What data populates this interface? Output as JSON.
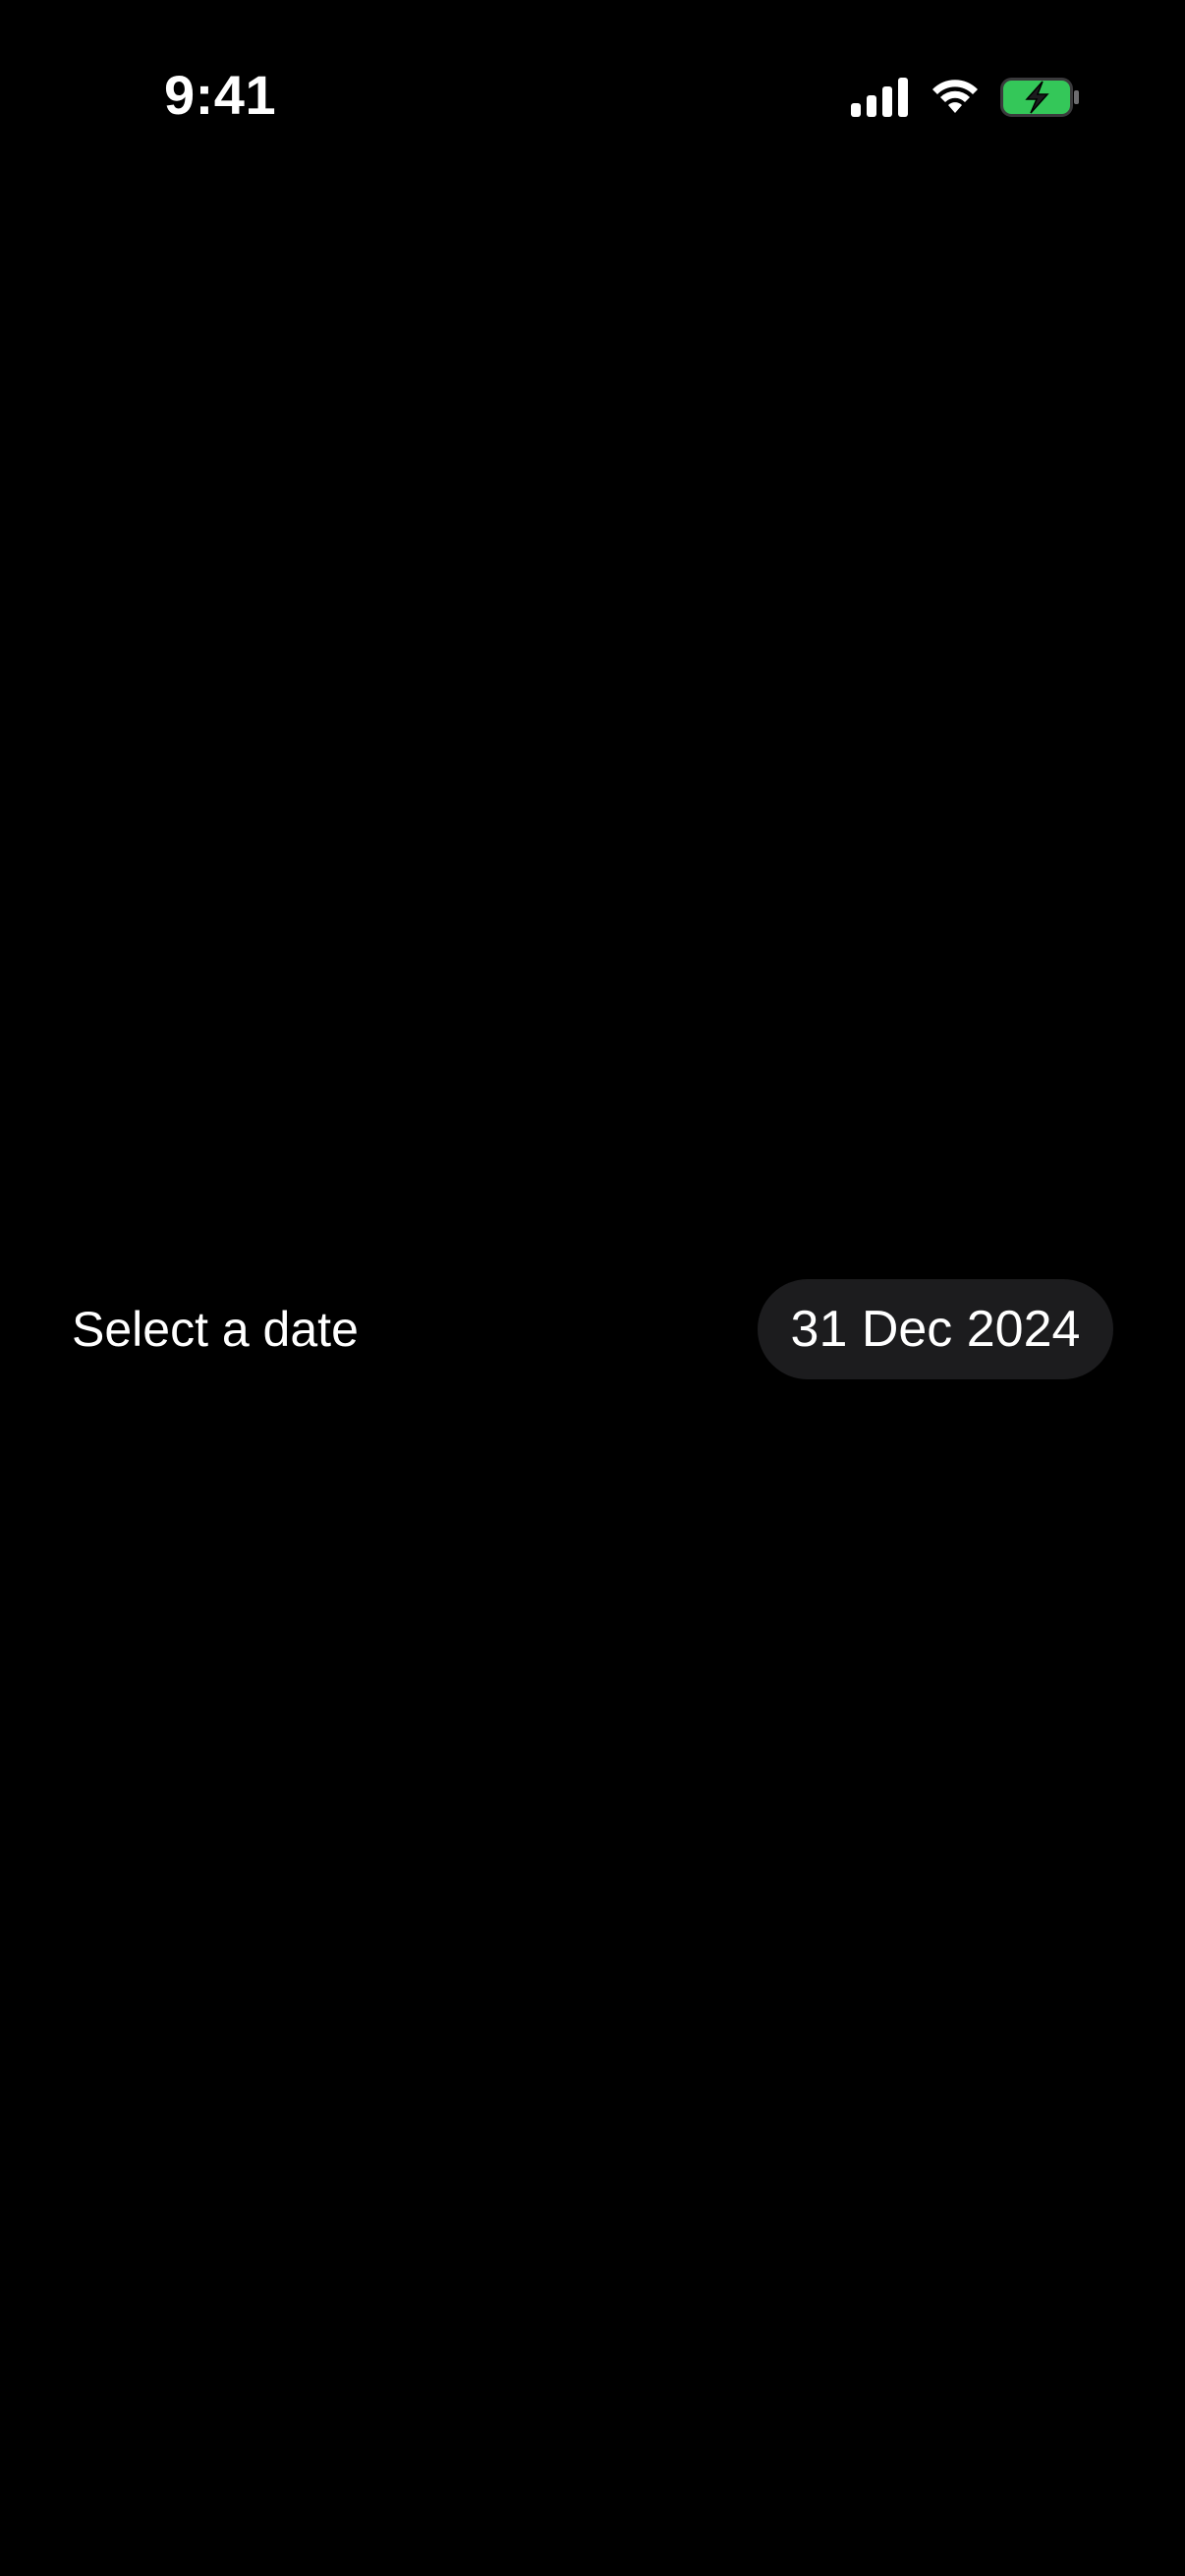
{
  "status_bar": {
    "time": "9:41",
    "icons": [
      "cellular-signal-icon",
      "wifi-icon",
      "battery-charging-icon"
    ],
    "battery_color": "#34c759"
  },
  "date_row": {
    "label": "Select a date",
    "selected_date": "31 Dec 2024"
  },
  "colors": {
    "background": "#000000",
    "pill_background": "#1c1c1e",
    "text": "#ffffff"
  }
}
